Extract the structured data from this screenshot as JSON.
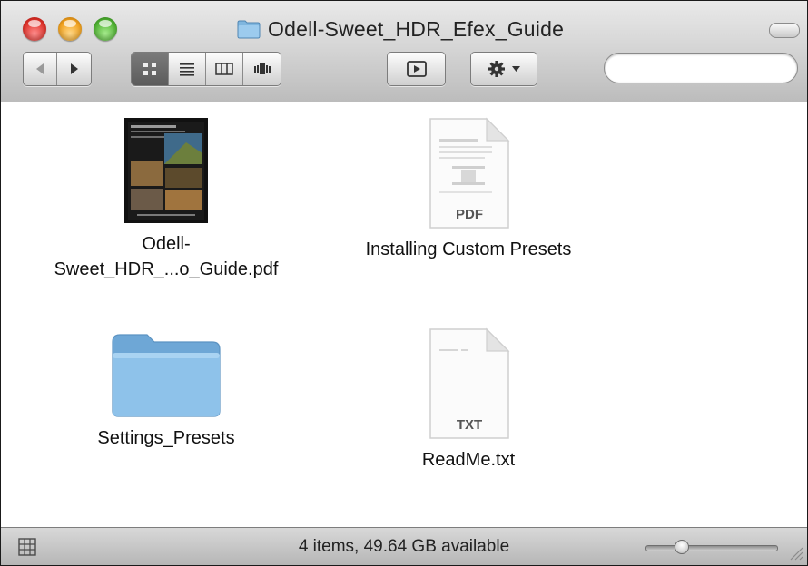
{
  "window": {
    "title": "Odell-Sweet_HDR_Efex_Guide"
  },
  "toolbar": {
    "nav_buttons": [
      {
        "icon": "back-arrow-icon"
      },
      {
        "icon": "forward-arrow-icon"
      }
    ],
    "view_buttons": [
      {
        "icon": "icon-view-icon",
        "selected": true
      },
      {
        "icon": "list-view-icon",
        "selected": false
      },
      {
        "icon": "column-view-icon",
        "selected": false
      },
      {
        "icon": "cover-flow-icon",
        "selected": false
      }
    ],
    "quicklook_icon": "quick-look-icon",
    "action_icon": "gear-icon",
    "search": {
      "value": "",
      "placeholder": ""
    }
  },
  "items": [
    {
      "name_line1": "Odell-",
      "name_line2": "Sweet_HDR_...o_Guide.pdf",
      "kind": "pdf-document-thumbnail"
    },
    {
      "name": "Installing Custom Presets",
      "kind": "pdf",
      "badge": "PDF"
    },
    {
      "name": "Settings_Presets",
      "kind": "folder"
    },
    {
      "name": "ReadMe.txt",
      "kind": "txt",
      "badge": "TXT"
    }
  ],
  "status": {
    "text": "4 items, 49.64 GB available",
    "zoom_level": 0.25
  },
  "colors": {
    "close": "#e0342c",
    "minimize": "#f3a320",
    "zoom": "#52b435",
    "folder": "#7fb6df"
  }
}
